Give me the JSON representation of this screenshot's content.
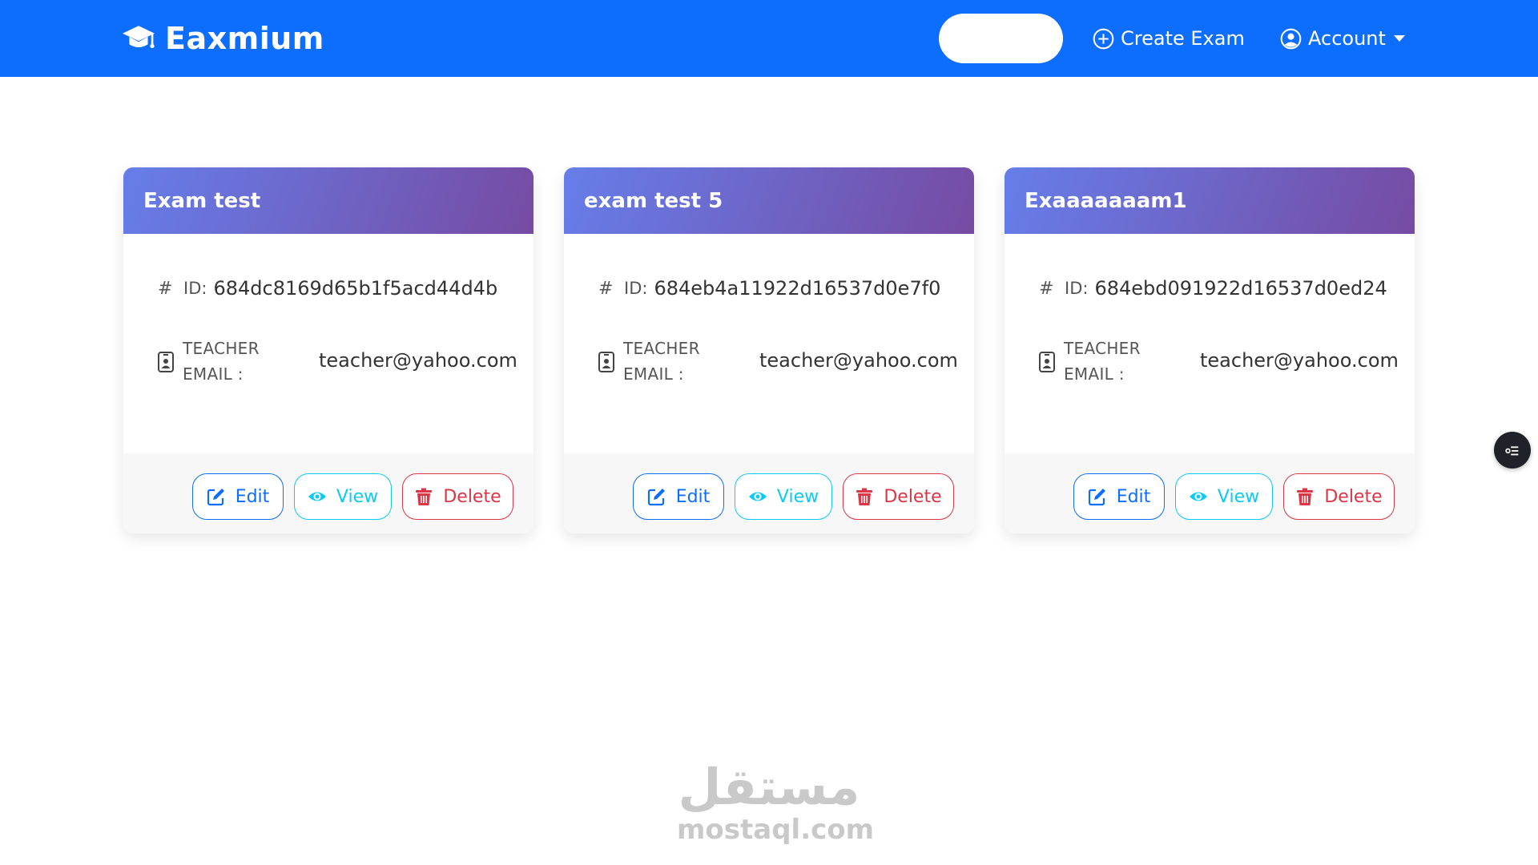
{
  "navbar": {
    "brand": "Eaxmium",
    "brand_icon": "graduation-cap-icon",
    "create_exam": "Create Exam",
    "account": "Account",
    "color": "#0d6efd"
  },
  "cards": [
    {
      "title": "Exam test",
      "id_label": "ID:",
      "id": "684dc8169d65b1f5acd44d4b",
      "email_label": "TEACHER EMAIL :",
      "email": "teacher@yahoo.com",
      "edit": "Edit",
      "view": "View",
      "delete": "Delete"
    },
    {
      "title": "exam test 5",
      "id_label": "ID:",
      "id": "684eb4a11922d16537d0e7f0",
      "email_label": "TEACHER EMAIL :",
      "email": "teacher@yahoo.com",
      "edit": "Edit",
      "view": "View",
      "delete": "Delete"
    },
    {
      "title": "Exaaaaaaam1",
      "id_label": "ID:",
      "id": "684ebd091922d16537d0ed24",
      "email_label": "TEACHER EMAIL :",
      "email": "teacher@yahoo.com",
      "edit": "Edit",
      "view": "View",
      "delete": "Delete"
    }
  ],
  "colors": {
    "header_gradient_start": "#667eea",
    "header_gradient_end": "#764ba2",
    "edit": "#0d6efd",
    "view": "#0dcaf0",
    "delete": "#dc3545"
  },
  "watermark": {
    "arabic": "مستقل",
    "latin": "mostaql.com"
  }
}
